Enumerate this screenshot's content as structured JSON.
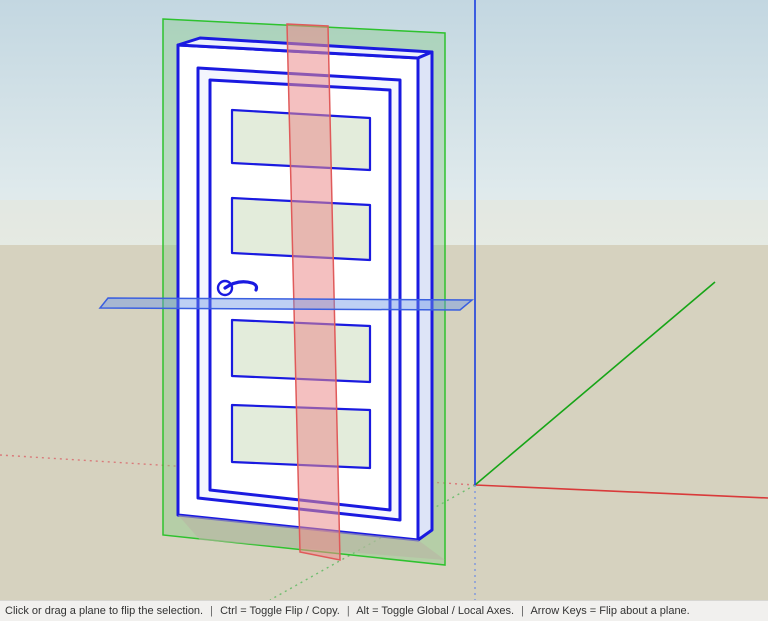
{
  "statusbar": {
    "hint_main": "Click or drag a plane to flip the selection.",
    "hint_ctrl": "Ctrl = Toggle Flip / Copy.",
    "hint_alt": "Alt = Toggle Global / Local Axes.",
    "hint_arrows": "Arrow Keys = Flip about a plane.",
    "separator": "|"
  },
  "scene": {
    "sky_top": "#c3d7e1",
    "sky_bottom": "#e7efef",
    "ground": "#d6d2bf",
    "axis_red": "#e03030",
    "axis_green": "#17a517",
    "axis_blue": "#1a3ee0",
    "door_outline": "#1a1ae0",
    "door_face": "#ffffff",
    "plane_red": "rgba(230,120,120,0.55)",
    "plane_green": "rgba(130,200,130,0.45)",
    "plane_blue": "rgba(110,150,230,0.45)"
  }
}
